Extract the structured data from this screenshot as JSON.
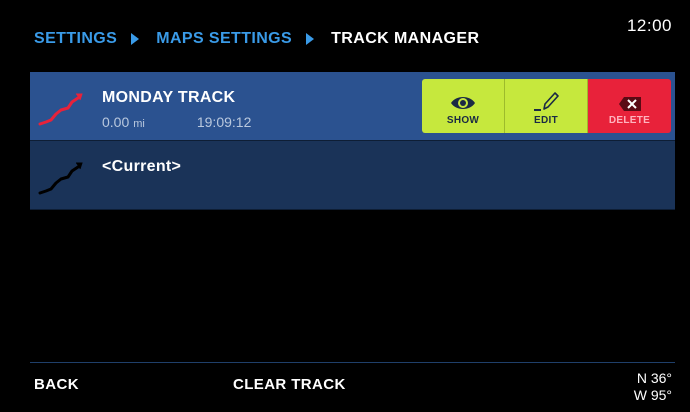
{
  "status": {
    "time": "12:00"
  },
  "breadcrumb": {
    "items": [
      "SETTINGS",
      "MAPS SETTINGS",
      "TRACK MANAGER"
    ]
  },
  "tracks": [
    {
      "name": "MONDAY TRACK",
      "distance": "0.00",
      "unit": "mi",
      "duration": "19:09:12",
      "selected": true,
      "icon_color": "#e8223a"
    },
    {
      "name": "<Current>",
      "selected": false,
      "icon_color": "#000000"
    }
  ],
  "actions": {
    "show": "SHOW",
    "edit": "EDIT",
    "delete": "DELETE"
  },
  "footer": {
    "back": "BACK",
    "clear": "CLEAR TRACK",
    "lat": "N 36°",
    "lon": "W 95°"
  },
  "colors": {
    "accent": "#3a9be8",
    "selected_row": "#2b5290",
    "row": "#1a3358",
    "action_green": "#c6e83d",
    "action_red": "#e8223a"
  },
  "icons": [
    "track-line-icon",
    "eye-icon",
    "pencil-icon",
    "delete-x-icon"
  ]
}
